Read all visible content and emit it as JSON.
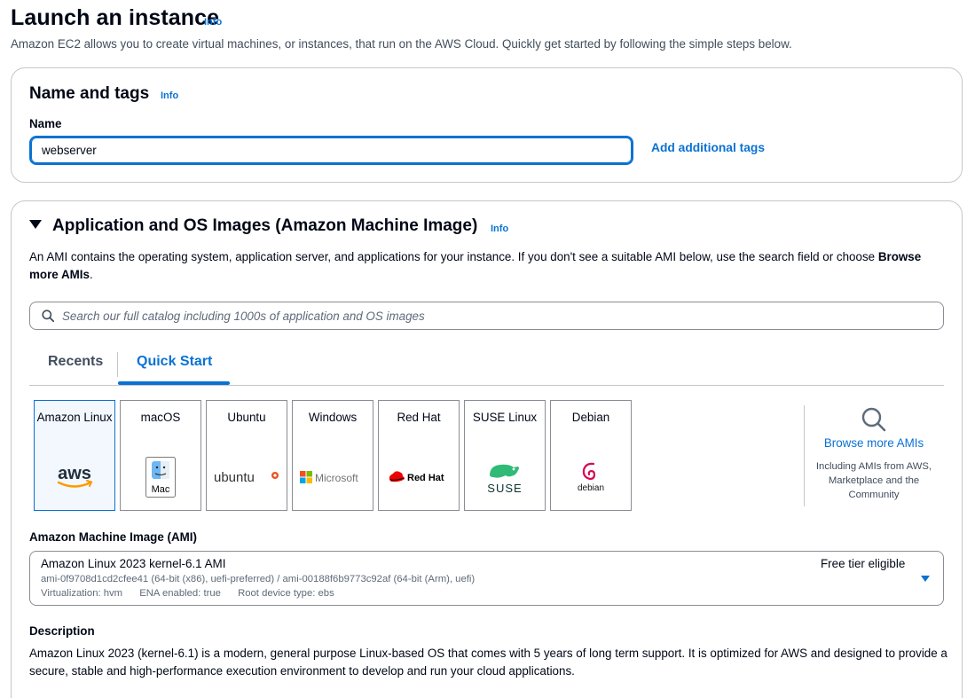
{
  "header": {
    "title": "Launch an instance",
    "info": "Info",
    "description": "Amazon EC2 allows you to create virtual machines, or instances, that run on the AWS Cloud. Quickly get started by following the simple steps below."
  },
  "name_tags": {
    "title": "Name and tags",
    "info": "Info",
    "name_label": "Name",
    "name_value": "webserver",
    "add_tags_label": "Add additional tags"
  },
  "ami_section": {
    "title": "Application and OS Images (Amazon Machine Image)",
    "info": "Info",
    "description_prefix": "An AMI contains the operating system, application server, and applications for your instance. If you don't see a suitable AMI below, use the search field or choose ",
    "description_bold": "Browse more AMIs",
    "description_suffix": ".",
    "search_placeholder": "Search our full catalog including 1000s of application and OS images",
    "tabs": [
      {
        "label": "Recents",
        "active": false
      },
      {
        "label": "Quick Start",
        "active": true
      }
    ],
    "os_cards": [
      {
        "name": "Amazon Linux",
        "logo_text": "aws",
        "selected": true
      },
      {
        "name": "macOS",
        "logo_text": "Mac",
        "selected": false
      },
      {
        "name": "Ubuntu",
        "logo_text": "ubuntu",
        "selected": false
      },
      {
        "name": "Windows",
        "logo_text": "Microsoft",
        "selected": false
      },
      {
        "name": "Red Hat",
        "logo_text": "Red Hat",
        "selected": false
      },
      {
        "name": "SUSE Linux",
        "logo_text": "SUSE",
        "selected": false
      },
      {
        "name": "Debian",
        "logo_text": "debian",
        "selected": false
      }
    ],
    "browse": {
      "label": "Browse more AMIs",
      "sub": "Including AMIs from AWS, Marketplace and the Community"
    },
    "ami_label": "Amazon Machine Image (AMI)",
    "ami_selected": {
      "name": "Amazon Linux 2023 kernel-6.1 AMI",
      "ids": "ami-0f9708d1cd2cfee41 (64-bit (x86), uefi-preferred) / ami-00188f6b9773c92af (64-bit (Arm), uefi)",
      "virtualization": "Virtualization: hvm",
      "ena": "ENA enabled: true",
      "root_device": "Root device type: ebs",
      "badge": "Free tier eligible"
    },
    "description_label": "Description",
    "description_text": "Amazon Linux 2023 (kernel-6.1) is a modern, general purpose Linux-based OS that comes with 5 years of long term support. It is optimized for AWS and designed to provide a secure, stable and high-performance execution environment to develop and run your cloud applications."
  },
  "colors": {
    "accent": "#0972d3",
    "selected_bg": "#f2f8fd",
    "border": "#8c8c94"
  }
}
